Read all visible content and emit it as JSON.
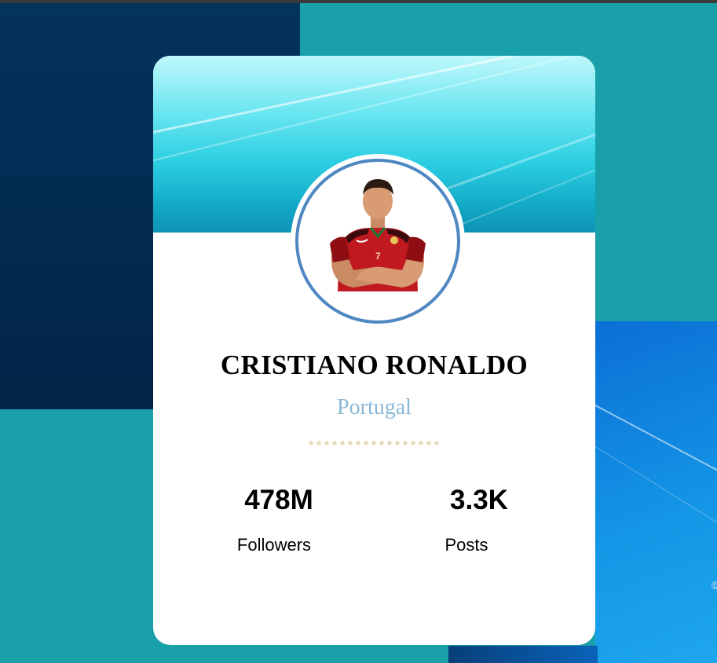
{
  "profile": {
    "name": "CRISTIANO RONALDO",
    "country": "Portugal",
    "stats": [
      {
        "value": "478M",
        "label": "Followers"
      },
      {
        "value": "3.3K",
        "label": "Posts"
      }
    ]
  },
  "background_fragment": "©",
  "colors": {
    "avatar_ring": "#4f87c2",
    "country_text": "#8bb8d6",
    "dots": "#e8dcc0",
    "jersey": "#c0191f"
  }
}
